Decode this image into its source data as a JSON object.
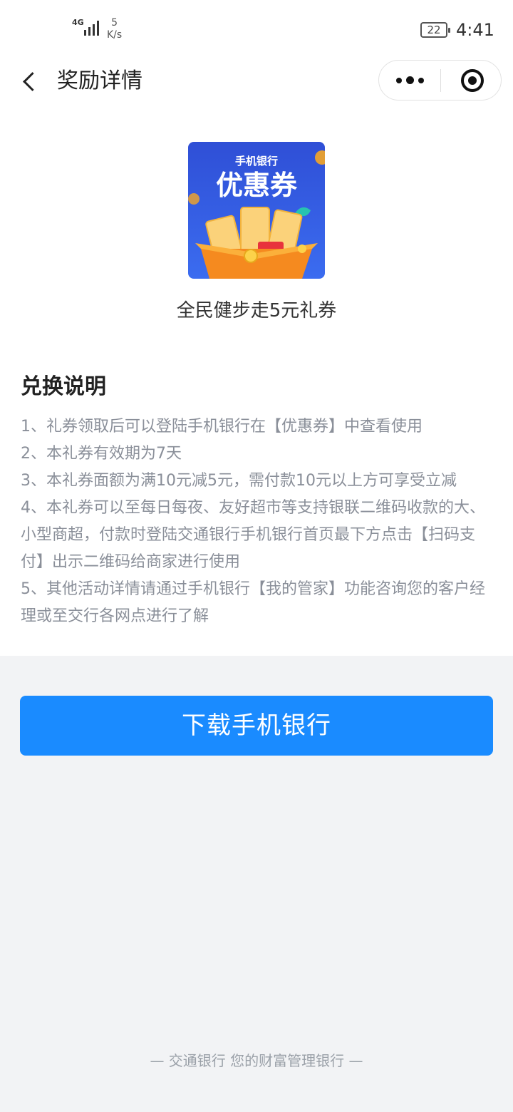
{
  "status_bar": {
    "network": "4G",
    "speed_value": "5",
    "speed_unit": "K/s",
    "battery": "22",
    "time": "4:41"
  },
  "nav": {
    "title": "奖励详情",
    "back_icon": "chevron-left-icon",
    "more_icon": "more-dots-icon",
    "close_icon": "target-close-icon"
  },
  "coupon": {
    "image_brand": "手机银行",
    "image_title": "优惠券",
    "ticket_text": "优惠券",
    "name": "全民健步走5元礼券"
  },
  "rules": {
    "title": "兑换说明",
    "items": [
      "1、礼券领取后可以登陆手机银行在【优惠券】中查看使用",
      "2、本礼券有效期为7天",
      "3、本礼券面额为满10元减5元，需付款10元以上方可享受立减",
      "4、本礼券可以至每日每夜、友好超市等支持银联二维码收款的大、小型商超，付款时登陆交通银行手机银行首页最下方点击【扫码支付】出示二维码给商家进行使用",
      "5、其他活动详情请通过手机银行【我的管家】功能咨询您的客户经理或至交行各网点进行了解"
    ]
  },
  "download_button": "下载手机银行",
  "footer": "— 交通银行 您的财富管理银行 —",
  "colors": {
    "accent": "#1a8bff",
    "page_bg": "#f2f3f5",
    "rule_text": "#8a8f99"
  }
}
